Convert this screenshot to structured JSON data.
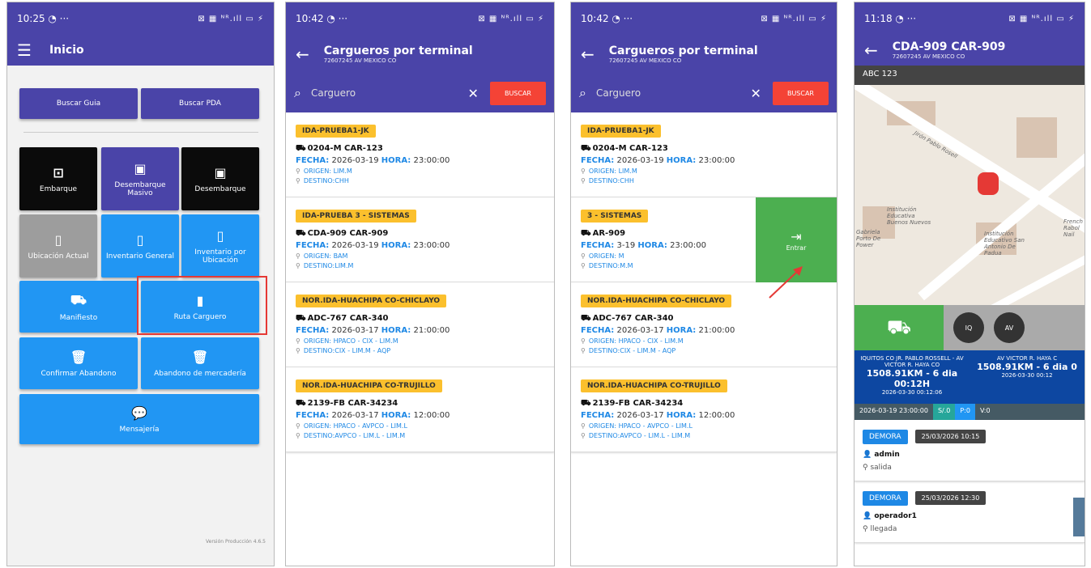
{
  "p1": {
    "status_time": "10:25 ◔ ···",
    "status_right": "⊠ ▦ ᴺᴿ.ıll ▭ ⚡",
    "title": "Inicio",
    "buttons": {
      "buscar_guia": "Buscar Guia",
      "buscar_pda": "Buscar PDA",
      "embarque": "Embarque",
      "desembarque_masivo": "Desembarque Masivo",
      "desembarque": "Desembarque",
      "ubicacion_actual": "Ubicación Actual",
      "inventario_general": "Inventario General",
      "inventario_ubicacion": "Inventario por Ubicación",
      "manifiesto": "Manifiesto",
      "ruta_carguero": "Ruta Carguero",
      "confirmar_abandono": "Confirmar Abandono",
      "abandono_mercaderia": "Abandono de mercadería",
      "mensajeria": "Mensajería"
    },
    "version": "Versión Producción 4.6.5"
  },
  "p2": {
    "status_time": "10:42 ◔ ···",
    "title": "Cargueros por terminal",
    "subtitle": "72607245 AV MEXICO CO",
    "search_placeholder": "Carguero",
    "search_btn": "BUSCAR",
    "labels": {
      "fecha": "FECHA:",
      "hora": "HORA:",
      "origen": "ORIGEN:",
      "destino": "DESTINO:"
    },
    "cards": [
      {
        "badge": "IDA-PRUEBA1-JK",
        "vehicle": "0204-M CAR-123",
        "fecha": "2026-03-19",
        "hora": "23:00:00",
        "origen": "LIM.M",
        "destino": "CHH"
      },
      {
        "badge": "IDA-PRUEBA 3 - SISTEMAS",
        "vehicle": "CDA-909 CAR-909",
        "fecha": "2026-03-19",
        "hora": "23:00:00",
        "origen": "BAM",
        "destino": "LIM.M"
      },
      {
        "badge": "NOR.IDA-HUACHIPA CO-CHICLAYO",
        "vehicle": "ADC-767 CAR-340",
        "fecha": "2026-03-17",
        "hora": "21:00:00",
        "origen": "HPACO - CIX - LIM.M",
        "destino": "CIX - LIM.M - AQP"
      },
      {
        "badge": "NOR.IDA-HUACHIPA CO-TRUJILLO",
        "vehicle": "2139-FB CAR-34234",
        "fecha": "2026-03-17",
        "hora": "12:00:00",
        "origen": "HPACO - AVPCO - LIM.L",
        "destino": "AVPCO - LIM.L - LIM.M"
      }
    ]
  },
  "p3": {
    "search_placeholder": "Carguero",
    "swipe_card": {
      "badge": "3 - SISTEMAS",
      "vehicle": "AR-909",
      "fecha": "3-19",
      "hora": "23:00:00",
      "origen": "M",
      "destino": "M.M"
    },
    "swipe_action": "Entrar"
  },
  "p4": {
    "status_time": "11:18 ◔ ···",
    "title": "CDA-909 CAR-909",
    "subtitle": "72607245 AV MEXICO CO",
    "plate": "ABC 123",
    "map_labels": [
      "Jirón Pablo Rosell",
      "Institución Educativa Buenos Nuevos",
      "Institución Educativo San Antonio De Padua",
      "Gabriela Porto De Power",
      "French Rabol Nail"
    ],
    "chip_iq": "IQ",
    "chip_av": "AV",
    "route": [
      {
        "name": "IQUITOS CO JR. PABLO ROSSELL - AV VICTOR R. HAYA CO",
        "km": "1508.91KM - 6 dia 00:12H",
        "date": "2026-03-30 00:12:06"
      },
      {
        "name": "AV VICTOR R. HAYA C",
        "km": "1508.91KM - 6 dia 0",
        "date": "2026-03-30 00:12"
      }
    ],
    "stats": {
      "datetime": "2026-03-19 23:00:00",
      "s": "S/.0",
      "p": "P:0",
      "v": "V:0"
    },
    "events": [
      {
        "type": "DEMORA",
        "date": "25/03/2026 10:15",
        "user": "admin",
        "detail": "salida"
      },
      {
        "type": "DEMORA",
        "date": "25/03/2026 12:30",
        "user": "operador1",
        "detail": "llegada"
      }
    ]
  }
}
